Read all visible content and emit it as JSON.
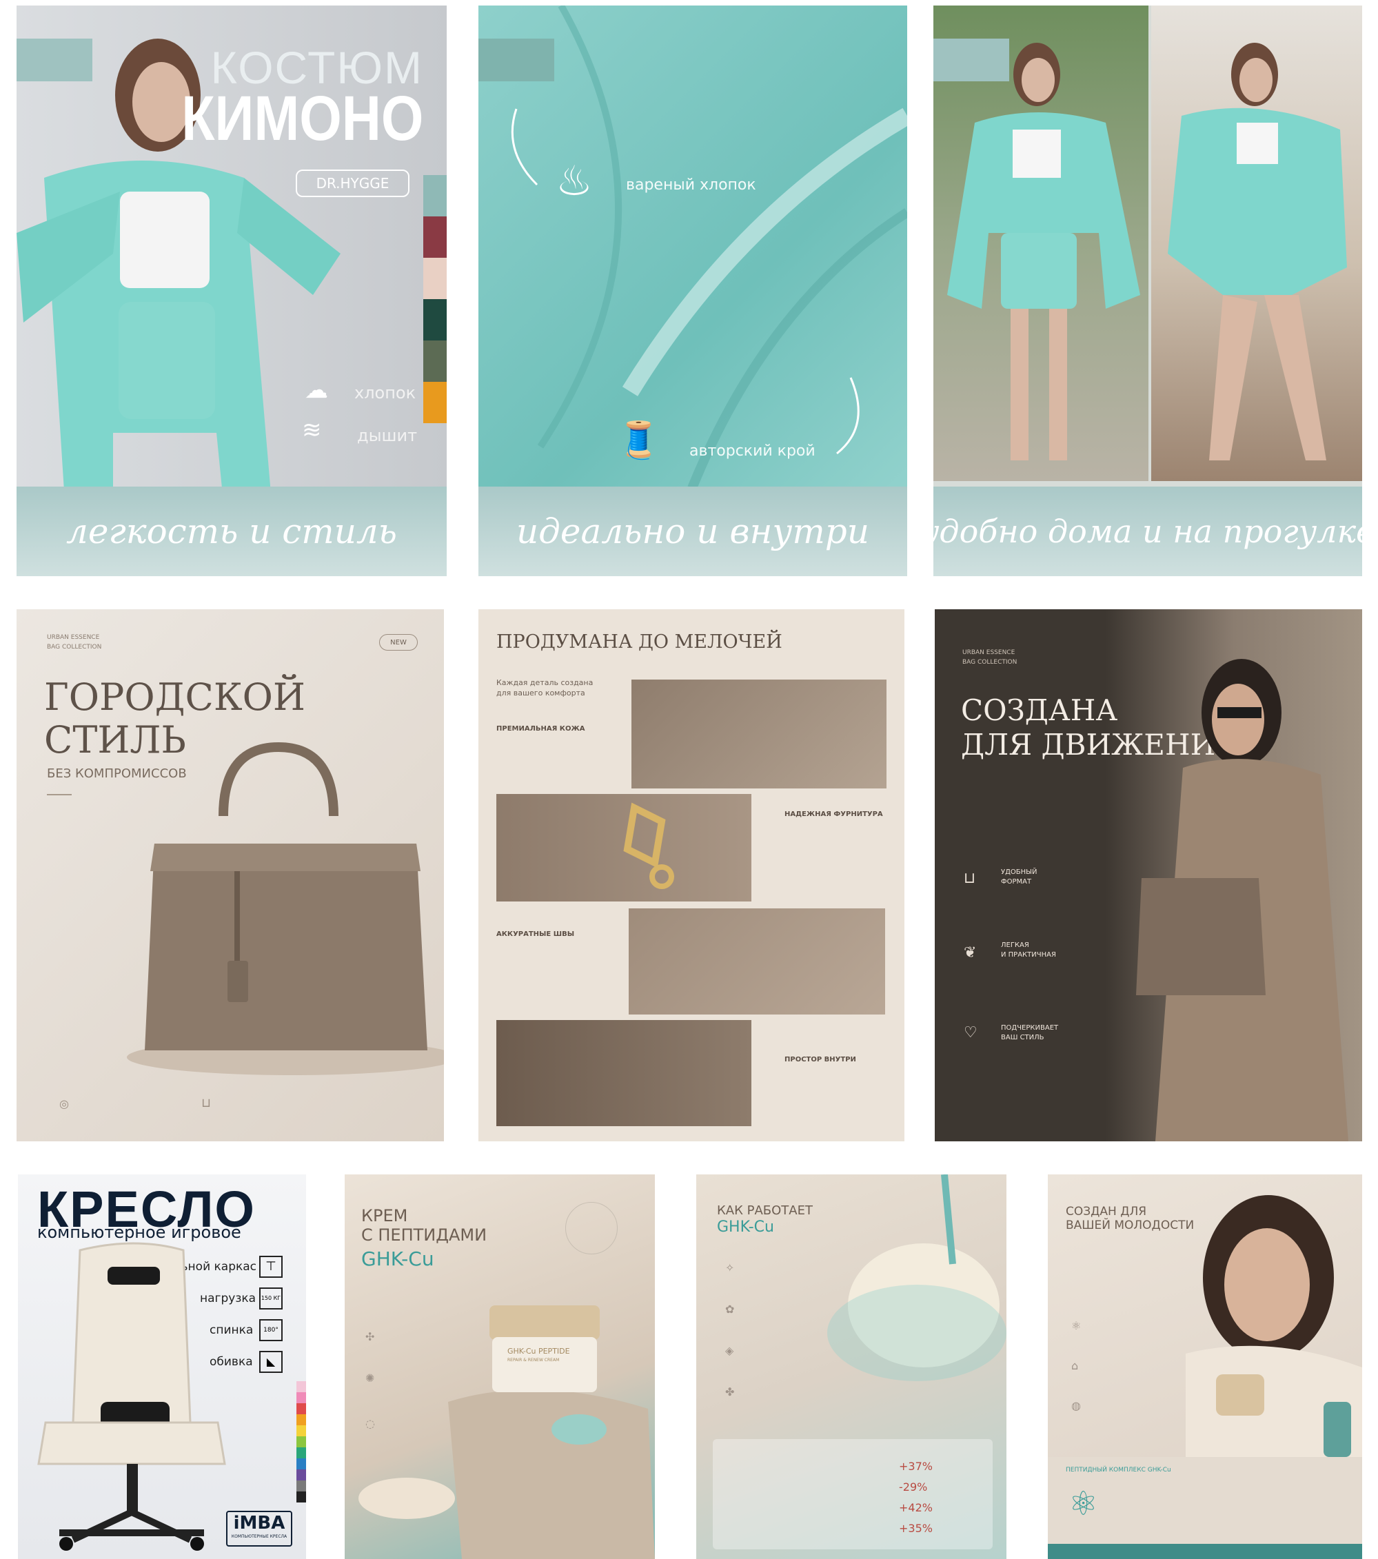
{
  "cards": {
    "kimono_1": {
      "title_top": "КОСТЮМ",
      "title_main": "КИМОНО",
      "brand": "DR.HYGGE",
      "feature_1": "хлопок",
      "feature_2": "дышит",
      "banner": "легкость и стиль",
      "swatches": [
        "#8fb9b6",
        "#8a3a44",
        "#e9d0c4",
        "#1f4a40",
        "#5c6b54",
        "#e89a1e"
      ]
    },
    "kimono_2": {
      "feature_1": "вареный хлопок",
      "feature_2": "авторский крой",
      "banner": "идеально и внутри"
    },
    "kimono_3": {
      "banner": "удобно дома и на прогулке"
    },
    "bag_1": {
      "eyebrow_1": "URBAN ESSENCE",
      "eyebrow_2": "BAG COLLECTION",
      "badge": "NEW",
      "title_1": "ГОРОДСКОЙ",
      "title_2": "СТИЛЬ",
      "subtitle": "БЕЗ КОМПРОМИССОВ"
    },
    "bag_2": {
      "title": "ПРОДУМАНА ДО МЕЛОЧЕЙ",
      "intro_1": "Каждая деталь создана",
      "intro_2": "для вашего комфорта",
      "label_1": "ПРЕМИАЛЬНАЯ КОЖА",
      "label_2": "НАДЕЖНАЯ ФУРНИТУРА",
      "label_3": "АККУРАТНЫЕ ШВЫ",
      "label_4": "ПРОСТОР ВНУТРИ"
    },
    "bag_3": {
      "eyebrow_1": "URBAN ESSENCE",
      "eyebrow_2": "BAG COLLECTION",
      "title_1": "СОЗДАНА",
      "title_2": "ДЛЯ ДВИЖЕНИЯ",
      "feature_1": "УДОБНЫЙ",
      "feature_1b": "ФОРМАТ",
      "feature_2": "ЛЕГКАЯ",
      "feature_2b": "И ПРАКТИЧНАЯ",
      "feature_3": "ПОДЧЕРКИВАЕТ",
      "feature_3b": "ВАШ СТИЛЬ"
    },
    "chair": {
      "title": "КРЕСЛО",
      "subtitle": "компьютерное игровое",
      "spec_1": "стальной каркас",
      "spec_2": "нагрузка",
      "spec_2_value": "150 КГ",
      "spec_3": "спинка",
      "spec_3_value": "180°",
      "spec_4": "обивка",
      "brand": "iMBA",
      "brand_sub": "КОМПЬЮТЕРНЫЕ КРЕСЛА",
      "swatches": [
        "#f3c6d8",
        "#f08bb8",
        "#e04b4b",
        "#f0a020",
        "#f4d23a",
        "#8cc63f",
        "#2aa67a",
        "#2a7fc4",
        "#6a4c9c",
        "#7a7a7a",
        "#222222"
      ]
    },
    "cream_1": {
      "title_1": "КРЕМ",
      "title_2": "С ПЕПТИДАМИ",
      "title_3": "GHK-Cu",
      "jar_label": "GHK-Cu PEPTIDE",
      "jar_sub": "REPAIR & RENEW CREAM"
    },
    "cream_2": {
      "title_1": "КАК РАБОТАЕТ",
      "title_2": "GHK-Cu",
      "stat_1": "+37%",
      "stat_2": "-29%",
      "stat_3": "+42%",
      "stat_4": "+35%"
    },
    "cream_3": {
      "title_1": "СОЗДАН ДЛЯ",
      "title_2": "ВАШЕЙ МОЛОДОСТИ",
      "complex": "ПЕПТИДНЫЙ КОМПЛЕКС GHK-Cu"
    }
  }
}
